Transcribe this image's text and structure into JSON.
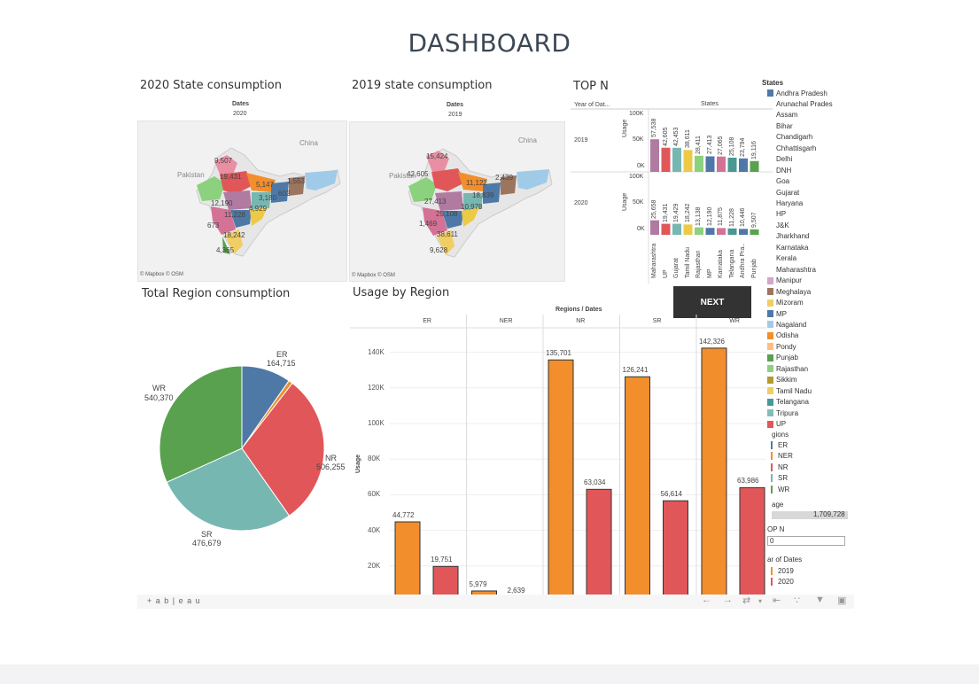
{
  "page_title": "DASHBOARD",
  "state_2020": {
    "title": "2020 State consumption",
    "header_label": "Dates",
    "header_value": "2020",
    "credit": "© Mapbox © OSM",
    "country_labels": [
      "China",
      "Pakistan"
    ],
    "values": [
      "9,507",
      "19,431",
      "5,147",
      "1,553",
      "602",
      "3,180",
      "4,929",
      "12,190",
      "11,228",
      "673",
      "18,242",
      "4,365"
    ]
  },
  "state_2019": {
    "title": "2019 state consumption",
    "header_label": "Dates",
    "header_value": "2019",
    "credit": "© Mapbox © OSM",
    "country_labels": [
      "China",
      "Pakistan"
    ],
    "values": [
      "15,424",
      "42,605",
      "11,122",
      "2,439",
      "18,839",
      "27,413",
      "10,978",
      "25,108",
      "1,469",
      "38,611",
      "9,628"
    ]
  },
  "top_n": {
    "title": "TOP N",
    "col_year": "Year of Dat...",
    "col_states": "States",
    "y_axis": "Usage",
    "ticks_upper": [
      "100K",
      "50K",
      "0K"
    ],
    "ticks_lower": [
      "100K",
      "50K",
      "0K"
    ],
    "categories": [
      "Maharashtra",
      "UP",
      "Gujarat",
      "Tamil Nadu",
      "Rajasthan",
      "MP",
      "Karnataka",
      "Telangana",
      "Andhra Pra..",
      "Punjab"
    ],
    "rows": [
      {
        "year": "2019",
        "values": [
          57538,
          42605,
          42453,
          38611,
          28411,
          27413,
          27065,
          25108,
          23794,
          19116
        ],
        "labels": [
          "57,538",
          "42,605",
          "42,453",
          "38,611",
          "28,411",
          "27,413",
          "27,065",
          "25,108",
          "23,794",
          "19,116"
        ]
      },
      {
        "year": "2020",
        "values": [
          25658,
          19431,
          19429,
          18242,
          13138,
          12190,
          11875,
          11228,
          10446,
          9507
        ],
        "labels": [
          "25,658",
          "19,431",
          "19,429",
          "18,242",
          "13,138",
          "12,190",
          "11,875",
          "11,228",
          "10,446",
          "9,507"
        ]
      }
    ],
    "colors": [
      "#b07aa1",
      "#e15759",
      "#76b7b2",
      "#edc948",
      "#8cd17d",
      "#4e79a7",
      "#d37295",
      "#499894",
      "#4e79a7",
      "#59a14f"
    ]
  },
  "next_button": "NEXT",
  "legend": {
    "states_title": "States",
    "states": [
      {
        "name": "Andhra Pradesh",
        "color": "#4e79a7"
      },
      {
        "name": "Arunachal Prades",
        "color": ""
      },
      {
        "name": "Assam",
        "color": ""
      },
      {
        "name": "Bihar",
        "color": ""
      },
      {
        "name": "Chandigarh",
        "color": ""
      },
      {
        "name": "Chhattisgarh",
        "color": ""
      },
      {
        "name": "Delhi",
        "color": ""
      },
      {
        "name": "DNH",
        "color": ""
      },
      {
        "name": "Goa",
        "color": ""
      },
      {
        "name": "Gujarat",
        "color": ""
      },
      {
        "name": "Haryana",
        "color": ""
      },
      {
        "name": "HP",
        "color": ""
      },
      {
        "name": "J&K",
        "color": ""
      },
      {
        "name": "Jharkhand",
        "color": ""
      },
      {
        "name": "Karnataka",
        "color": ""
      },
      {
        "name": "Kerala",
        "color": ""
      },
      {
        "name": "Maharashtra",
        "color": ""
      },
      {
        "name": "Manipur",
        "color": "#d4a6c8"
      },
      {
        "name": "Meghalaya",
        "color": "#9d7660"
      },
      {
        "name": "Mizoram",
        "color": "#f1ce63"
      },
      {
        "name": "MP",
        "color": "#4e79a7"
      },
      {
        "name": "Nagaland",
        "color": "#a0cbe8"
      },
      {
        "name": "Odisha",
        "color": "#f28e2b"
      },
      {
        "name": "Pondy",
        "color": "#ffbe7d"
      },
      {
        "name": "Punjab",
        "color": "#59a14f"
      },
      {
        "name": "Rajasthan",
        "color": "#8cd17d"
      },
      {
        "name": "Sikkim",
        "color": "#b6992d"
      },
      {
        "name": "Tamil Nadu",
        "color": "#f1ce63"
      },
      {
        "name": "Telangana",
        "color": "#499894"
      },
      {
        "name": "Tripura",
        "color": "#86bcb6"
      },
      {
        "name": "UP",
        "color": "#e15759"
      }
    ],
    "regions_title": "gions",
    "regions": [
      {
        "name": "ER",
        "color": "#4e79a7"
      },
      {
        "name": "NER",
        "color": "#f28e2b"
      },
      {
        "name": "NR",
        "color": "#e15759"
      },
      {
        "name": "SR",
        "color": "#76b7b2"
      },
      {
        "name": "WR",
        "color": "#59a14f"
      }
    ],
    "usage_title": "age",
    "usage_value": "1,709,728",
    "topn_title": "OP N",
    "topn_value": "0",
    "dates_title": "ar of Dates",
    "dates": [
      {
        "name": "2019",
        "color": "#f28e2b"
      },
      {
        "name": "2020",
        "color": "#e15759"
      }
    ]
  },
  "total_region": {
    "title": "Total Region consumption",
    "chart_data": {
      "type": "pie",
      "labels": [
        "ER",
        "NER",
        "NR",
        "SR",
        "WR"
      ],
      "values": [
        164715,
        14000,
        506255,
        476679,
        540370
      ],
      "value_labels": [
        "164,715",
        "",
        "506,255",
        "476,679",
        "540,370"
      ],
      "colors": [
        "#4e79a7",
        "#f28e2b",
        "#e15759",
        "#76b7b2",
        "#59a14f"
      ]
    }
  },
  "usage_by_region": {
    "title": "Usage by Region",
    "header": "Regions / Dates",
    "y_label": "Usage",
    "chart_data": {
      "type": "bar",
      "regions": [
        "ER",
        "NER",
        "NR",
        "SR",
        "WR"
      ],
      "series": [
        {
          "name": "2019",
          "color": "#f28e2b",
          "values": [
            44772,
            5979,
            135701,
            126241,
            142326
          ],
          "labels": [
            "44,772",
            "5,979",
            "135,701",
            "126,241",
            "142,326"
          ]
        },
        {
          "name": "2020",
          "color": "#e15759",
          "values": [
            19751,
            2639,
            63034,
            56614,
            63986
          ],
          "labels": [
            "19,751",
            "2,639",
            "63,034",
            "56,614",
            "63,986"
          ]
        }
      ],
      "yticks": [
        "140K",
        "120K",
        "100K",
        "80K",
        "60K",
        "40K",
        "20K"
      ],
      "ylim": [
        0,
        150000
      ]
    }
  },
  "footer": {
    "brand": "+ a b | e a u"
  }
}
